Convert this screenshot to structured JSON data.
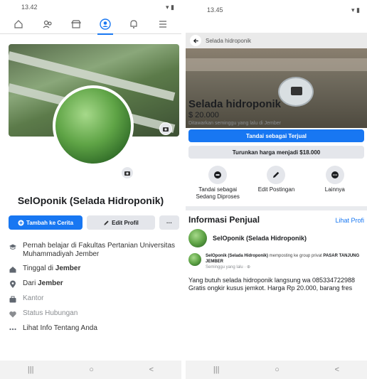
{
  "left": {
    "status_time": "13.42",
    "profile_name": "SelOponik (Selada Hidroponik)",
    "btn_story": "Tambah ke Cerita",
    "btn_edit": "Edit Profil",
    "btn_more": "···",
    "info": {
      "studied": "Pernah belajar di Fakultas Pertanian Universitas Muhammadiyah Jember",
      "lives_prefix": "Tinggal di ",
      "lives_city": "Jember",
      "from_prefix": "Dari ",
      "from_city": "Jember",
      "work": "Kantor",
      "relationship": "Status Hubungan",
      "about": "Lihat Info Tentang Anda"
    }
  },
  "right": {
    "status_time": "13.45",
    "header_title": "Selada hidroponik",
    "title": "Selada hidroponik",
    "price": "$ 20.000",
    "offered": "Ditawarkan seminggu yang lalu di Jember",
    "btn_sold": "Tandai sebagai Terjual",
    "btn_price": "Turunkan harga menjadi $18.000",
    "actions": {
      "mark_pending": "Tandai sebagai Sedang Diproses",
      "edit_post": "Edit Postingan",
      "more": "Lainnya"
    },
    "seller_info": "Informasi Penjual",
    "view_profile": "Lihat Profi",
    "seller_name": "SelOponik (Selada Hidroponik)",
    "post_author": "SelOponik (Selada Hidroponik)",
    "post_mid": " memposting ke group privat ",
    "post_group": "PASAR TANJUNG JEMBER",
    "post_time": "Seminggu yang lalu · ⊕",
    "description": "Yang butuh selada hidroponik langsung wa 085334722988 Gratis ongkir kusus jemkot. Harga Rp 20.000, barang fres"
  },
  "sysnav": {
    "recent": "|||",
    "home": "○",
    "back": "<"
  },
  "colors": {
    "accent": "#1877f2",
    "button_grey": "#e4e6eb"
  }
}
